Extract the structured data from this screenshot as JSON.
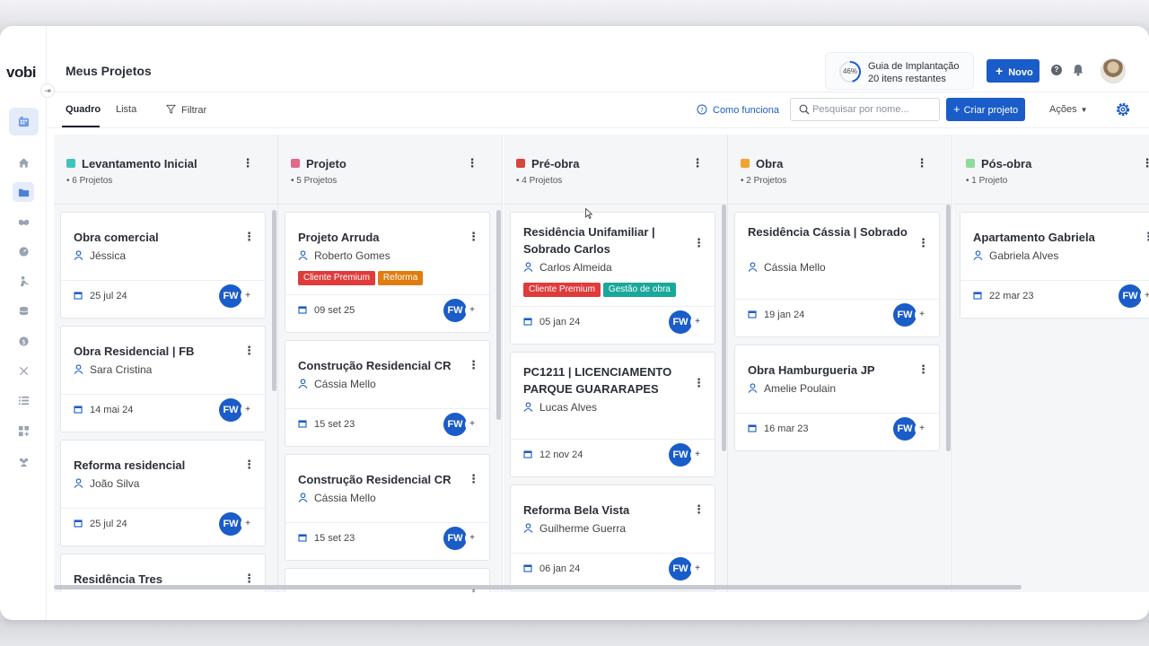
{
  "app": {
    "logo": "vobi",
    "page_title": "Meus Projetos"
  },
  "guide": {
    "percent": "46%",
    "progress": 0.46,
    "title": "Guia de Implantação",
    "subtitle": "20 itens restantes"
  },
  "header": {
    "new_button": "Novo",
    "help_icon": "?"
  },
  "toolbar": {
    "tabs": [
      {
        "label": "Quadro",
        "active": true
      },
      {
        "label": "Lista",
        "active": false
      }
    ],
    "filter_label": "Filtrar",
    "how_label": "Como funciona",
    "search_placeholder": "Pesquisar por nome...",
    "create_label": "Criar projeto",
    "actions_label": "Ações"
  },
  "columns": [
    {
      "title": "Levantamento Inicial",
      "count": "• 6 Projetos",
      "color": "#3fc4bd",
      "cards": [
        {
          "title": "Obra comercial",
          "owner": "Jéssica",
          "date": "25 jul 24",
          "assignee": "FW",
          "tags": []
        },
        {
          "title": "Obra Residencial | FB",
          "owner": "Sara Cristina",
          "date": "14 mai 24",
          "assignee": "FW",
          "tags": []
        },
        {
          "title": "Reforma residencial",
          "owner": "João Silva",
          "date": "25 jul 24",
          "assignee": "FW",
          "tags": []
        },
        {
          "title": "Residência Tres",
          "owner": "",
          "date": "",
          "assignee": "",
          "tags": []
        }
      ]
    },
    {
      "title": "Projeto",
      "count": "• 5 Projetos",
      "color": "#e1698a",
      "cards": [
        {
          "title": "Projeto Arruda",
          "owner": "Roberto Gomes",
          "date": "09 set 25",
          "assignee": "FW",
          "tags": [
            {
              "label": "Cliente Premium",
              "color": "#e03b3b"
            },
            {
              "label": "Reforma",
              "color": "#e07d10"
            }
          ]
        },
        {
          "title": "Construção Residencial CR",
          "owner": "Cássia Mello",
          "date": "15 set 23",
          "assignee": "FW",
          "tags": []
        },
        {
          "title": "Construção Residencial CR",
          "owner": "Cássia Mello",
          "date": "15 set 23",
          "assignee": "FW",
          "tags": []
        },
        {
          "title": "",
          "owner": "",
          "date": "",
          "assignee": "",
          "tags": []
        }
      ]
    },
    {
      "title": "Pré-obra",
      "count": "• 4 Projetos",
      "color": "#d9443c",
      "cards": [
        {
          "title": "Residência Unifamiliar | Sobrado Carlos",
          "owner": "Carlos Almeida",
          "date": "05 jan 24",
          "assignee": "FW",
          "tags": [
            {
              "label": "Cliente Premium",
              "color": "#e03b3b"
            },
            {
              "label": "Gestão de obra",
              "color": "#1aa89b"
            }
          ]
        },
        {
          "title": "PC1211 | LICENCIAMENTO PARQUE GUARARAPES",
          "owner": "Lucas Alves",
          "date": "12 nov 24",
          "assignee": "FW",
          "tags": []
        },
        {
          "title": "Reforma Bela Vista",
          "owner": "Guilherme Guerra",
          "date": "06 jan 24",
          "assignee": "FW",
          "tags": []
        }
      ]
    },
    {
      "title": "Obra",
      "count": "• 2 Projetos",
      "color": "#f0a430",
      "cards": [
        {
          "title": "Residência Cássia | Sobrado",
          "owner": "Cássia Mello",
          "date": "19 jan 24",
          "assignee": "FW",
          "tags": []
        },
        {
          "title": "Obra Hamburgueria JP",
          "owner": "Amelie Poulain",
          "date": "16 mar 23",
          "assignee": "FW",
          "tags": []
        }
      ]
    },
    {
      "title": "Pós-obra",
      "count": "• 1 Projeto",
      "color": "#8fdb9c",
      "cards": [
        {
          "title": "Apartamento Gabriela",
          "owner": "Gabriela Alves",
          "date": "22 mar 23",
          "assignee": "FW",
          "tags": []
        }
      ]
    }
  ],
  "colors": {
    "primary": "#1a5cc8",
    "sidebar_active_bg": "#e4ecfa"
  },
  "sidebar_icons": [
    "board-icon",
    "home-icon",
    "folder-icon",
    "handshake-icon",
    "gauge-icon",
    "worker-icon",
    "coins-icon",
    "dollar-icon",
    "tools-icon",
    "list-icon",
    "grid-add-icon",
    "team-icon"
  ]
}
